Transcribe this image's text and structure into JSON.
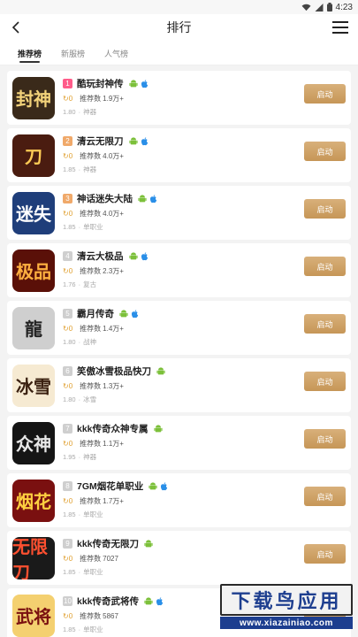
{
  "status_bar": {
    "time": "4:23"
  },
  "header": {
    "title": "排行"
  },
  "tabs": [
    {
      "label": "推荐榜",
      "active": true
    },
    {
      "label": "新服榜",
      "active": false
    },
    {
      "label": "人气榜",
      "active": false
    }
  ],
  "common": {
    "rec_label": "推荐数",
    "start_label": "启动",
    "coin": "0"
  },
  "games": [
    {
      "rank": "1",
      "rank_style": "pink",
      "name": "酷玩封神传",
      "android": true,
      "ios": true,
      "recommend": "1.9万+",
      "version": "1.80",
      "genre": "神器",
      "thumb_text": "封神",
      "thumb_bg": "#3a2a1a",
      "thumb_fg": "#f2d27a"
    },
    {
      "rank": "2",
      "rank_style": "gold",
      "name": "清云无限刀",
      "android": true,
      "ios": true,
      "recommend": "4.0万+",
      "version": "1.85",
      "genre": "神器",
      "thumb_text": "刀",
      "thumb_bg": "#4a1c10",
      "thumb_fg": "#ffcc55"
    },
    {
      "rank": "3",
      "rank_style": "gold",
      "name": "神话迷失大陆",
      "android": true,
      "ios": true,
      "recommend": "4.0万+",
      "version": "1.85",
      "genre": "单职业",
      "thumb_text": "迷失",
      "thumb_bg": "#1f3e7a",
      "thumb_fg": "#ffffff"
    },
    {
      "rank": "4",
      "rank_style": "gray",
      "name": "清云大极品",
      "android": true,
      "ios": true,
      "recommend": "2.3万+",
      "version": "1.76",
      "genre": "复古",
      "thumb_text": "极品",
      "thumb_bg": "#5a1008",
      "thumb_fg": "#ffb040"
    },
    {
      "rank": "5",
      "rank_style": "gray",
      "name": "霸月传奇",
      "android": true,
      "ios": true,
      "recommend": "1.4万+",
      "version": "1.80",
      "genre": "战神",
      "thumb_text": "龍",
      "thumb_bg": "#cfcfcf",
      "thumb_fg": "#222222"
    },
    {
      "rank": "6",
      "rank_style": "gray",
      "name": "笑傲冰雪极品快刀",
      "android": true,
      "ios": false,
      "recommend": "1.3万+",
      "version": "1.80",
      "genre": "冰雪",
      "thumb_text": "冰雪",
      "thumb_bg": "#f6ead2",
      "thumb_fg": "#3a2010"
    },
    {
      "rank": "7",
      "rank_style": "gray",
      "name": "kkk传奇众神专属",
      "android": true,
      "ios": false,
      "recommend": "1.1万+",
      "version": "1.95",
      "genre": "神器",
      "thumb_text": "众神",
      "thumb_bg": "#151515",
      "thumb_fg": "#e8e8e8"
    },
    {
      "rank": "8",
      "rank_style": "gray",
      "name": "7GM烟花单职业",
      "android": true,
      "ios": true,
      "recommend": "1.7万+",
      "version": "1.85",
      "genre": "单职业",
      "thumb_text": "烟花",
      "thumb_bg": "#7a1010",
      "thumb_fg": "#ffd040"
    },
    {
      "rank": "9",
      "rank_style": "gray",
      "name": "kkk传奇无限刀",
      "android": true,
      "ios": false,
      "recommend": "7027",
      "version": "1.85",
      "genre": "单职业",
      "thumb_text": "无限刀",
      "thumb_bg": "#1a1a1a",
      "thumb_fg": "#ff5030"
    },
    {
      "rank": "10",
      "rank_style": "gray",
      "name": "kkk传奇武将传",
      "android": true,
      "ios": true,
      "recommend": "5867",
      "version": "1.85",
      "genre": "单职业",
      "thumb_text": "武将",
      "thumb_bg": "#f4d070",
      "thumb_fg": "#7a1010"
    }
  ],
  "watermark": {
    "title": "下载鸟应用",
    "url": "www.xiazainiao.com"
  },
  "colors": {
    "start_button": "#cfa266",
    "coin": "#e0a030",
    "android": "#7cc03a",
    "ios": "#2a8fe8"
  }
}
